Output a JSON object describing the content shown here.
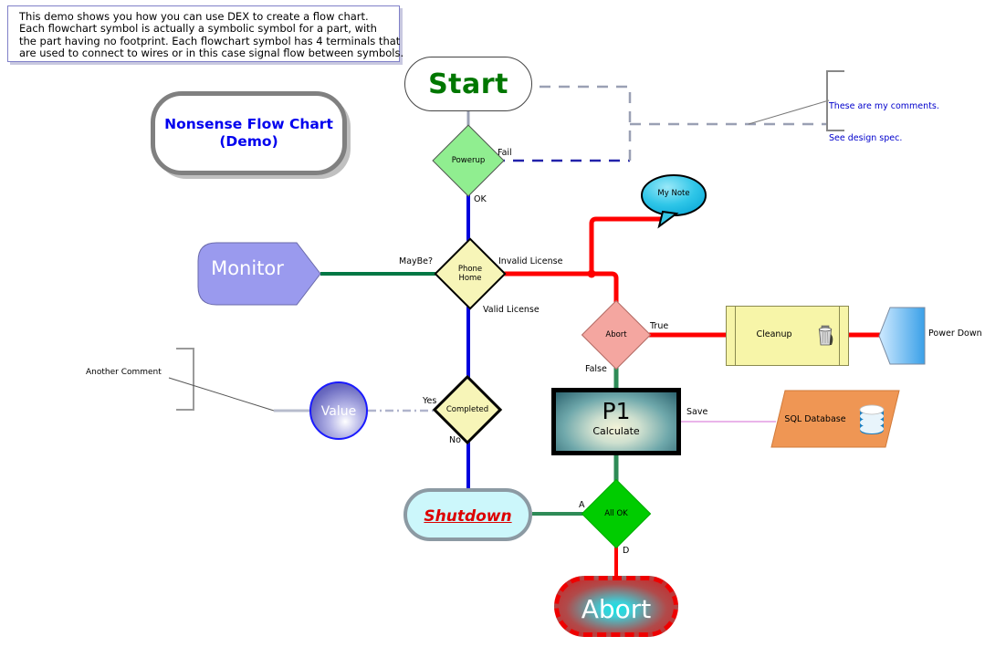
{
  "intro": {
    "lines": [
      "This demo shows you how you can use DEX to create a flow chart.",
      "Each flowchart symbol is actually a symbolic symbol for a part, with",
      "the part having no footprint. Each flowchart symbol has 4 terminals that",
      "are used to connect to wires or in this case signal flow between symbols."
    ]
  },
  "title": {
    "line1": "Nonsense Flow Chart",
    "line2": "(Demo)",
    "color": "#0000ee"
  },
  "nodes": {
    "start": {
      "label": "Start",
      "color": "#007700",
      "shape": "terminator"
    },
    "powerup": {
      "label": "Powerup",
      "fill": "#90ee90",
      "shape": "decision"
    },
    "monitor": {
      "label": "Monitor",
      "fill": "#9a9aee",
      "shape": "pentagon"
    },
    "phone_home": {
      "label": "Phone\nHome",
      "fill": "#f7f5b8",
      "shape": "decision"
    },
    "my_note": {
      "label": "My  Note",
      "fill": "#22c8ee",
      "shape": "callout"
    },
    "abort_decision": {
      "label": "Abort",
      "fill": "#f4a6a0",
      "shape": "decision"
    },
    "cleanup": {
      "label": "Cleanup",
      "fill": "#f7f5a8",
      "shape": "predefined-process",
      "icon": "trash-can-icon"
    },
    "power_down": {
      "label": "Power Down",
      "fill": "#4db3f0",
      "shape": "pentagon"
    },
    "value": {
      "label": "Value",
      "fill": "#6a6ac0",
      "shape": "circle"
    },
    "completed": {
      "label": "Completed",
      "fill": "#f7f5b8",
      "shape": "decision"
    },
    "p1": {
      "label": "P1",
      "sublabel": "Calculate",
      "shape": "process"
    },
    "sql_database": {
      "label": "SQL Database",
      "fill": "#ef9654",
      "shape": "parallelogram",
      "icon": "database-icon"
    },
    "shutdown": {
      "label": "Shutdown",
      "fill": "#ccf7fb",
      "color": "#dd0000",
      "shape": "terminator"
    },
    "all_ok": {
      "label": "All OK",
      "fill": "#00cc00",
      "shape": "decision"
    },
    "abort_final": {
      "label": "Abort",
      "color": "#ffffff",
      "shape": "terminator"
    }
  },
  "wire_labels": {
    "fail": "Fail",
    "ok": "OK",
    "maybe": "MayBe?",
    "invalid_license": "Invalid License",
    "valid_license": "Valid License",
    "true": "True",
    "false": "False",
    "save": "Save",
    "yes": "Yes",
    "no": "No",
    "a": "A",
    "d": "D",
    "all_ok_d": "D"
  },
  "comments": {
    "comment1_line1": "These are my comments.",
    "comment1_line2": "See design spec.",
    "comment2": "Another Comment"
  },
  "colors": {
    "red_wire": "#ff0000",
    "green_wire": "#007744",
    "blue_wire": "#0000dd",
    "gray_wire": "#9aa0b4",
    "magenta_wire": "#dd88dd"
  },
  "chart_data": {
    "type": "diagram",
    "title": "Nonsense Flow Chart (Demo)",
    "edges": [
      {
        "from": "start",
        "to": "powerup",
        "label": ""
      },
      {
        "from": "powerup",
        "to": "comment1",
        "label": "Fail"
      },
      {
        "from": "powerup",
        "to": "phone_home",
        "label": "OK"
      },
      {
        "from": "monitor",
        "to": "phone_home",
        "label": "MayBe?"
      },
      {
        "from": "phone_home",
        "to": "my_note",
        "label": "Invalid License"
      },
      {
        "from": "phone_home",
        "to": "abort_decision",
        "label": "Invalid License"
      },
      {
        "from": "phone_home",
        "to": "completed",
        "label": "Valid License"
      },
      {
        "from": "abort_decision",
        "to": "cleanup",
        "label": "True"
      },
      {
        "from": "cleanup",
        "to": "power_down",
        "label": ""
      },
      {
        "from": "abort_decision",
        "to": "p1",
        "label": "False"
      },
      {
        "from": "p1",
        "to": "sql_database",
        "label": "Save"
      },
      {
        "from": "value",
        "to": "completed",
        "label": "Yes"
      },
      {
        "from": "comment2",
        "to": "value",
        "label": ""
      },
      {
        "from": "completed",
        "to": "shutdown",
        "label": "No"
      },
      {
        "from": "shutdown",
        "to": "all_ok",
        "label": "A"
      },
      {
        "from": "p1",
        "to": "all_ok",
        "label": ""
      },
      {
        "from": "all_ok",
        "to": "abort_final",
        "label": "D"
      }
    ]
  }
}
